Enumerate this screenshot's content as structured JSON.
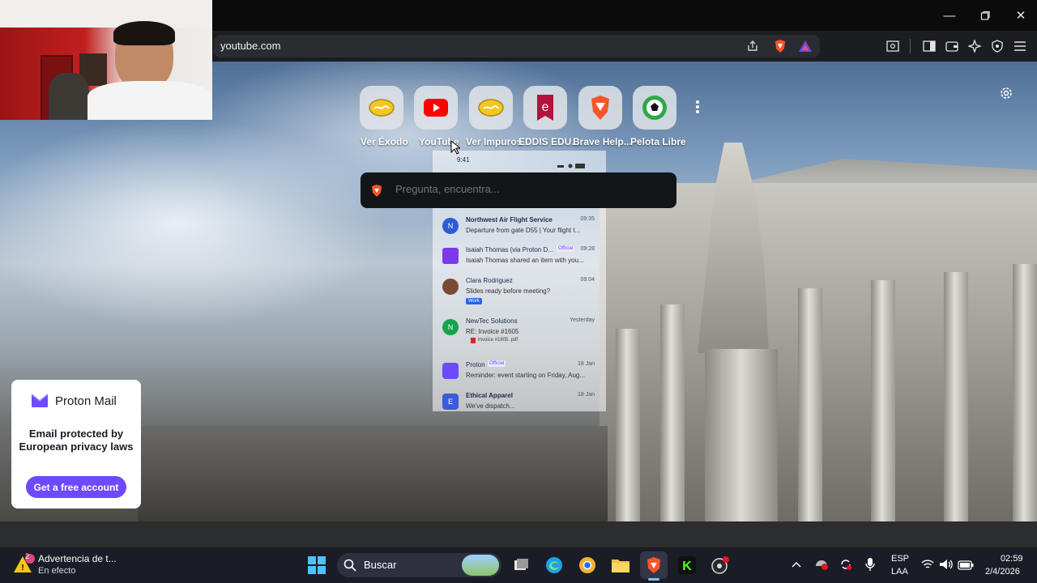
{
  "browser": {
    "url": "youtube.com",
    "window_controls": [
      "minimize-icon",
      "maximize-icon",
      "close-icon"
    ]
  },
  "newtab": {
    "shortcuts": [
      {
        "label": "Ver Éxodo",
        "icon": "gold-coin-icon"
      },
      {
        "label": "YouTube",
        "icon": "youtube-icon"
      },
      {
        "label": "Ver Impuros",
        "icon": "gold-coin-icon"
      },
      {
        "label": "EDDIS EDU...",
        "icon": "e-bookmark-icon"
      },
      {
        "label": "Brave Help...",
        "icon": "brave-lion-icon"
      },
      {
        "label": "Pelota Libre",
        "icon": "soccer-ball-icon"
      }
    ],
    "search_placeholder": "Pregunta, encuentra...",
    "colors": {
      "search_bg": "#141518",
      "brave_orange": "#fb542b"
    }
  },
  "phone_overlay": {
    "status_time": "9:41",
    "emails": [
      {
        "sender": "Northwest Air Flight Service",
        "time": "09:35",
        "subject": "Departure from gate D55 | Your flight t...",
        "avatar": "N"
      },
      {
        "sender": "Isaiah Thomas (via Proton D...",
        "badge": "Official",
        "time": "09:28",
        "subject": "Isaiah Thomas shared an item with you...",
        "avatar": ""
      },
      {
        "sender": "Clara Rodriguez",
        "time": "09:04",
        "subject": "Slides ready before meeting?",
        "tag": "Work",
        "avatar": ""
      },
      {
        "sender": "NewTec Solutions",
        "time": "Yesterday",
        "subject": "RE: Invoice #1605",
        "attachment": "Invoice #1605 .pdf",
        "avatar": "N"
      },
      {
        "sender": "Proton",
        "badge": "Official",
        "time": "18 Jan",
        "subject": "Reminder: event starting on Friday, Aug...",
        "avatar": ""
      },
      {
        "sender": "Ethical Apparel",
        "time": "18 Jan",
        "subject": "We've dispatch...",
        "avatar": "E"
      }
    ]
  },
  "ad": {
    "brand": "Proton Mail",
    "headline": "Email protected by European privacy laws",
    "cta": "Get a free account"
  },
  "taskbar": {
    "notification_title": "Advertencia de t...",
    "notification_subtitle": "En efecto",
    "notification_badge": "2",
    "search_label": "Buscar",
    "lang_top": "ESP",
    "lang_bottom": "LAA",
    "time": "02:59",
    "date": "2/4/2026"
  }
}
